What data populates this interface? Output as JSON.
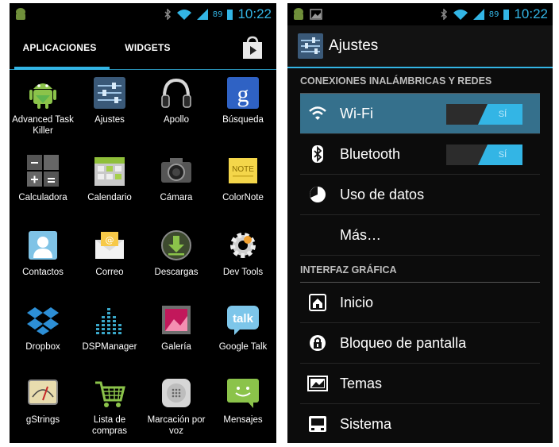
{
  "left": {
    "statusbar": {
      "battery": "89",
      "time": "10:22"
    },
    "tabs": {
      "apps": "APLICACIONES",
      "widgets": "WIDGETS"
    },
    "apps": [
      {
        "label": "Advanced Task Killer",
        "icon": "android-robot-icon"
      },
      {
        "label": "Ajustes",
        "icon": "settings-sliders-icon"
      },
      {
        "label": "Apollo",
        "icon": "headphones-icon"
      },
      {
        "label": "Búsqueda",
        "icon": "google-search-icon"
      },
      {
        "label": "Calculadora",
        "icon": "calculator-icon"
      },
      {
        "label": "Calendario",
        "icon": "calendar-icon"
      },
      {
        "label": "Cámara",
        "icon": "camera-icon"
      },
      {
        "label": "ColorNote",
        "icon": "note-icon"
      },
      {
        "label": "Contactos",
        "icon": "contacts-icon"
      },
      {
        "label": "Correo",
        "icon": "email-envelope-icon"
      },
      {
        "label": "Descargas",
        "icon": "download-icon"
      },
      {
        "label": "Dev Tools",
        "icon": "gear-icon"
      },
      {
        "label": "Dropbox",
        "icon": "dropbox-icon"
      },
      {
        "label": "DSPManager",
        "icon": "equalizer-icon"
      },
      {
        "label": "Galería",
        "icon": "gallery-icon"
      },
      {
        "label": "Google Talk",
        "icon": "talk-bubble-icon"
      },
      {
        "label": "gStrings",
        "icon": "tuner-meter-icon"
      },
      {
        "label": "Lista de compras",
        "icon": "shopping-cart-icon"
      },
      {
        "label": "Marcación por voz",
        "icon": "voice-dial-icon"
      },
      {
        "label": "Mensajes",
        "icon": "message-smiley-icon"
      }
    ],
    "talk_icon_text": "talk",
    "search_icon_text": "g",
    "note_icon_text": "NOTE"
  },
  "right": {
    "statusbar": {
      "battery": "89",
      "time": "10:22"
    },
    "title": "Ajustes",
    "sections": {
      "wireless": "CONEXIONES INALÁMBRICAS Y REDES",
      "ui": "INTERFAZ GRÁFICA"
    },
    "items": {
      "wifi": "Wi-Fi",
      "bluetooth": "Bluetooth",
      "data_usage": "Uso de datos",
      "more": "Más…",
      "home": "Inicio",
      "lock": "Bloqueo de pantalla",
      "themes": "Temas",
      "system": "Sistema"
    },
    "toggle_on_label": "SÍ"
  },
  "colors": {
    "accent": "#33b5e5",
    "selected_row": "#35708c"
  }
}
